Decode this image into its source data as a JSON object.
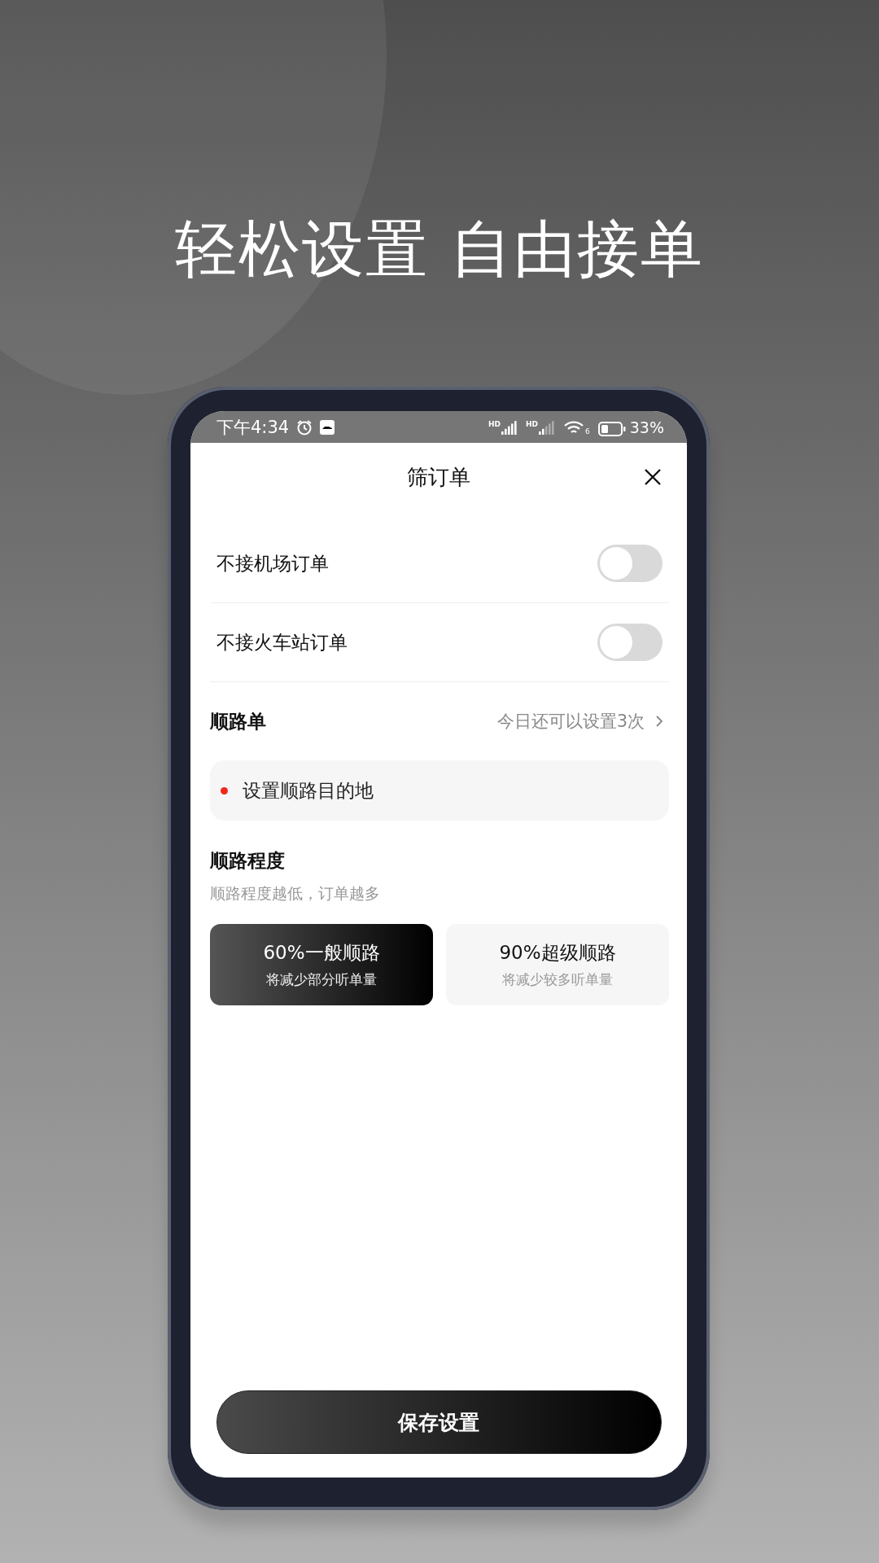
{
  "headline": "轻松设置 自由接单",
  "status_bar": {
    "time": "下午4:34",
    "signals": [
      {
        "label": "HD",
        "strong": true
      },
      {
        "label": "HD",
        "strong": false
      }
    ],
    "wifi_label": "6",
    "battery": "33%"
  },
  "sheet": {
    "title": "筛订单"
  },
  "toggles": [
    {
      "label": "不接机场订单",
      "on": false
    },
    {
      "label": "不接火车站订单",
      "on": false
    }
  ],
  "route_order": {
    "title": "顺路单",
    "hint": "今日还可以设置3次",
    "destination": "设置顺路目的地"
  },
  "route_degree": {
    "title": "顺路程度",
    "subtitle": "顺路程度越低，订单越多",
    "options": [
      {
        "title": "60%一般顺路",
        "note": "将减少部分听单量",
        "selected": true
      },
      {
        "title": "90%超级顺路",
        "note": "将减少较多听单量",
        "selected": false
      }
    ]
  },
  "save_button": "保存设置"
}
